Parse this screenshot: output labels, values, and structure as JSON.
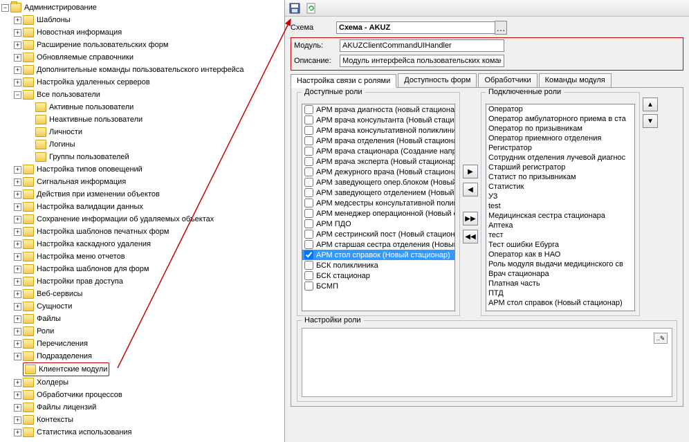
{
  "tree": {
    "root": "Администрирование",
    "nodes": [
      "Шаблоны",
      "Новостная информация",
      "Расширение пользовательских форм",
      "Обновляемые справочники",
      "Дополнительные команды пользовательского интерфейса",
      "Настройка удаленных серверов"
    ],
    "all_users": {
      "label": "Все пользователи",
      "children": [
        "Активные пользователи",
        "Неактивные пользователи",
        "Личности",
        "Логины",
        "Группы пользователей"
      ]
    },
    "rest": [
      "Настройка типов оповещений",
      "Сигнальная информация",
      "Действия при изменении объектов",
      "Настройка валидации данных",
      "Сохранение информации об удаляемых объектах",
      "Настройка шаблонов печатных форм",
      "Настройка каскадного удаления",
      "Настройка меню отчетов",
      "Настройка шаблонов для форм",
      "Настройки прав доступа",
      "Веб-сервисы",
      "Сущности",
      "Файлы",
      "Роли",
      "Перечисления",
      "Подразделения"
    ],
    "selected": "Клиентские модули",
    "tail": [
      "Холдеры",
      "Обработчики процессов",
      "Файлы лицензий",
      "Контексты",
      "Статистика использования"
    ]
  },
  "form": {
    "schema_label": "Схема",
    "schema_value": "Схема - AKUZ",
    "module_label": "Модуль:",
    "module_value": "AKUZClientCommandUIHandler",
    "desc_label": "Описание:",
    "desc_value": "Модуль интерфейса пользовательских команд"
  },
  "tabs": {
    "t1": "Настройка связи с ролями",
    "t2": "Доступность форм",
    "t3": "Обработчики",
    "t4": "Команды модуля"
  },
  "groups": {
    "available": "Доступные роли",
    "connected": "Подключенные роли",
    "settings": "Настройки роли"
  },
  "available_roles": [
    "АРМ врача диагноста (новый стационар)",
    "АРМ врача консультанта (Новый стацион",
    "АРМ врача консультативной поликлиник",
    "АРМ врача отделения (Новый стационар)",
    "АРМ врача стационара (Создание направ",
    "АРМ врача эксперта (Новый стационар)",
    "АРМ дежурного врача (Новый стационар)",
    "АРМ заведующего опер.блоком (Новый с",
    "АРМ заведующего отделением (Новый ст",
    "АРМ медсестры консультативной полик",
    "АРМ менеджер операционной (Новый ста",
    "АРМ ПДО",
    "АРМ сестринский пост (Новый стационар",
    "АРМ старшая сестра отделения (Новый с"
  ],
  "selected_role": "АРМ стол справок (Новый стационар)",
  "available_roles_tail": [
    "БСК поликлиника",
    "БСК стационар",
    "БСМП"
  ],
  "connected_roles": [
    "Оператор",
    "Оператор амбулаторного приема в ста",
    "Оператор по призывникам",
    "Оператор приемного отделения",
    "Регистратор",
    "Сотрудник отделения лучевой диагнос",
    "Старший регистратор",
    "Статист по призывникам",
    "Статистик",
    "УЗ",
    "test",
    "Медицинская сестра стационара",
    "Аптека",
    "тест",
    "Тест ошибки Ебурга",
    "Оператор как в НАО",
    "Роль модуля выдачи медицинского св",
    "Врач стационара",
    "Платная часть",
    "ПТД",
    "АРМ стол справок (Новый стационар)"
  ]
}
